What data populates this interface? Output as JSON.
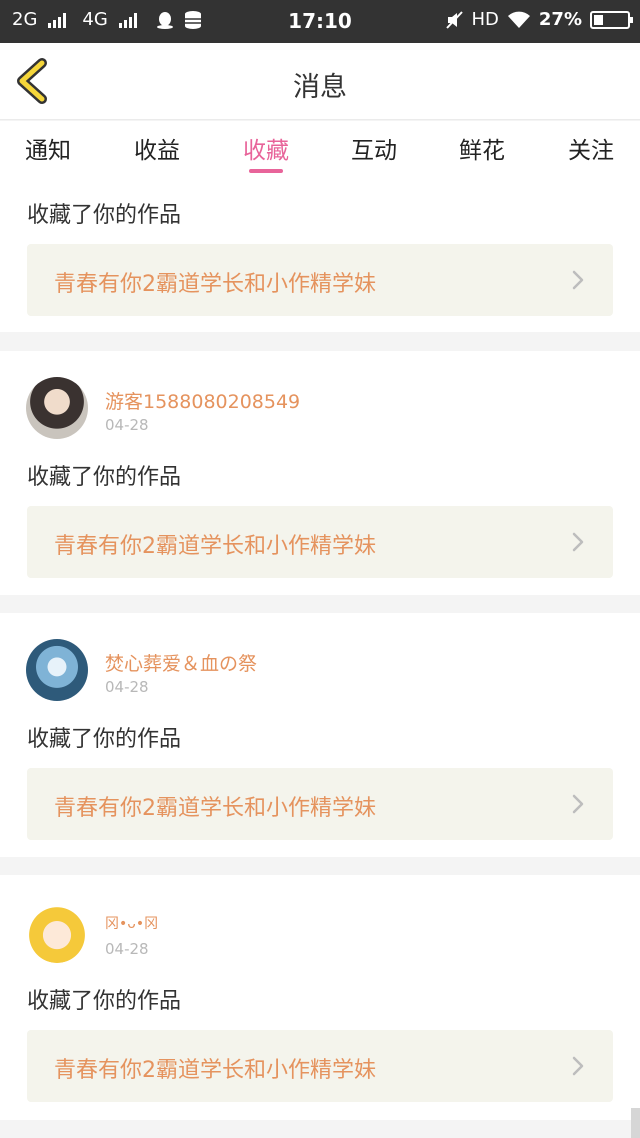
{
  "status_bar": {
    "network1": "2G",
    "network2": "4G",
    "time": "17:10",
    "hd": "HD",
    "battery": "27%"
  },
  "header": {
    "title": "消息",
    "back_icon": "chevron-left-icon"
  },
  "tabs": [
    {
      "label": "通知"
    },
    {
      "label": "收益"
    },
    {
      "label": "收藏",
      "active": true
    },
    {
      "label": "互动"
    },
    {
      "label": "鲜花"
    },
    {
      "label": "关注"
    }
  ],
  "accent_color": "#e8649a",
  "name_color": "#e5935e",
  "items": [
    {
      "action": "收藏了你的作品",
      "work": "青春有你2霸道学长和小作精学妹"
    },
    {
      "username": "游客1588080208549",
      "date": "04-28",
      "action": "收藏了你的作品",
      "work": "青春有你2霸道学长和小作精学妹"
    },
    {
      "username": "焚心葬爱＆血の祭",
      "date": "04-28",
      "action": "收藏了你的作品",
      "work": "青春有你2霸道学长和小作精学妹"
    },
    {
      "username": "冈•ᴗ•冈",
      "date": "04-28",
      "action": "收藏了你的作品",
      "work": "青春有你2霸道学长和小作精学妹"
    }
  ]
}
